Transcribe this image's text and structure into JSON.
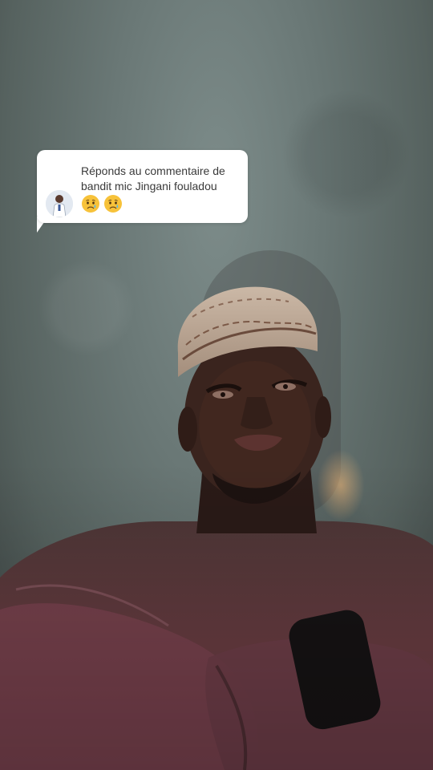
{
  "reply": {
    "prefix": "Réponds au commentaire de",
    "comment": "bandit mic Jingani fouladou",
    "emojis": [
      "crying-face",
      "crying-face"
    ],
    "avatar_icon": "profile-avatar-icon"
  },
  "colors": {
    "bubble_bg": "#ffffff",
    "bubble_text": "#3a3a3a",
    "wall": "#6a7876",
    "shirt": "#5b3b3a"
  }
}
